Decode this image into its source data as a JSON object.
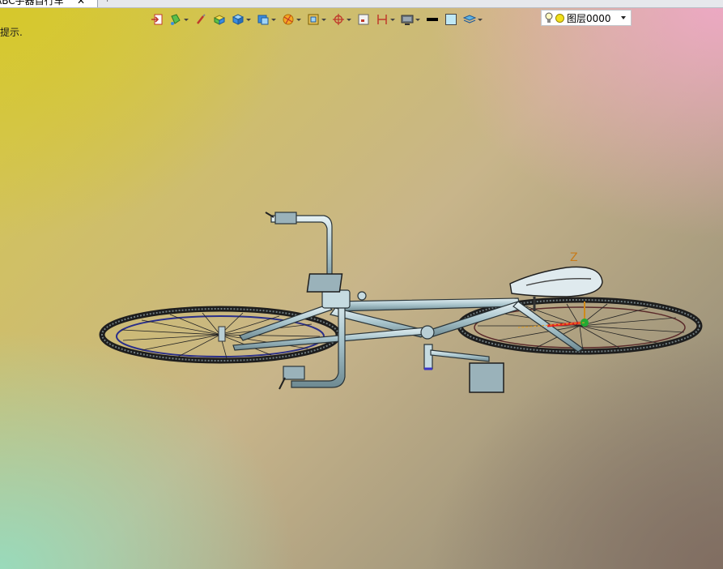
{
  "document_tab": {
    "title": "ABC手器自行车",
    "close_glyph": "✕",
    "add_glyph": "+"
  },
  "hint_text": "提示.",
  "toolbar": {
    "items": [
      {
        "icon": "import-icon",
        "has_dropdown": false
      },
      {
        "icon": "paint-bucket-icon",
        "has_dropdown": true
      },
      {
        "icon": "brush-icon",
        "has_dropdown": false
      },
      {
        "icon": "material-icon",
        "has_dropdown": false
      },
      {
        "icon": "solid-box-icon",
        "has_dropdown": true
      },
      {
        "icon": "view-cube-icon",
        "has_dropdown": true
      },
      {
        "icon": "section-icon",
        "has_dropdown": true
      },
      {
        "icon": "frame-icon",
        "has_dropdown": true
      },
      {
        "icon": "snap-target-icon",
        "has_dropdown": true
      },
      {
        "icon": "sheet-icon",
        "has_dropdown": false
      },
      {
        "icon": "dimension-icon",
        "has_dropdown": true
      },
      {
        "icon": "display-mode-icon",
        "has_dropdown": true
      },
      {
        "icon": "line-color-icon",
        "has_dropdown": false
      },
      {
        "icon": "fill-color-icon",
        "has_dropdown": false
      },
      {
        "icon": "layers-icon",
        "has_dropdown": true
      }
    ]
  },
  "layer": {
    "name": "图层0000",
    "color": "#f2e01c"
  },
  "viewport": {
    "axis_label": "Z",
    "background_colors": {
      "top_left": "#d6c828",
      "top_right": "#f0a8c8",
      "bottom_left": "#96dcbe",
      "bottom_right": "#806c60"
    },
    "model_color": "#a8c4cc"
  }
}
